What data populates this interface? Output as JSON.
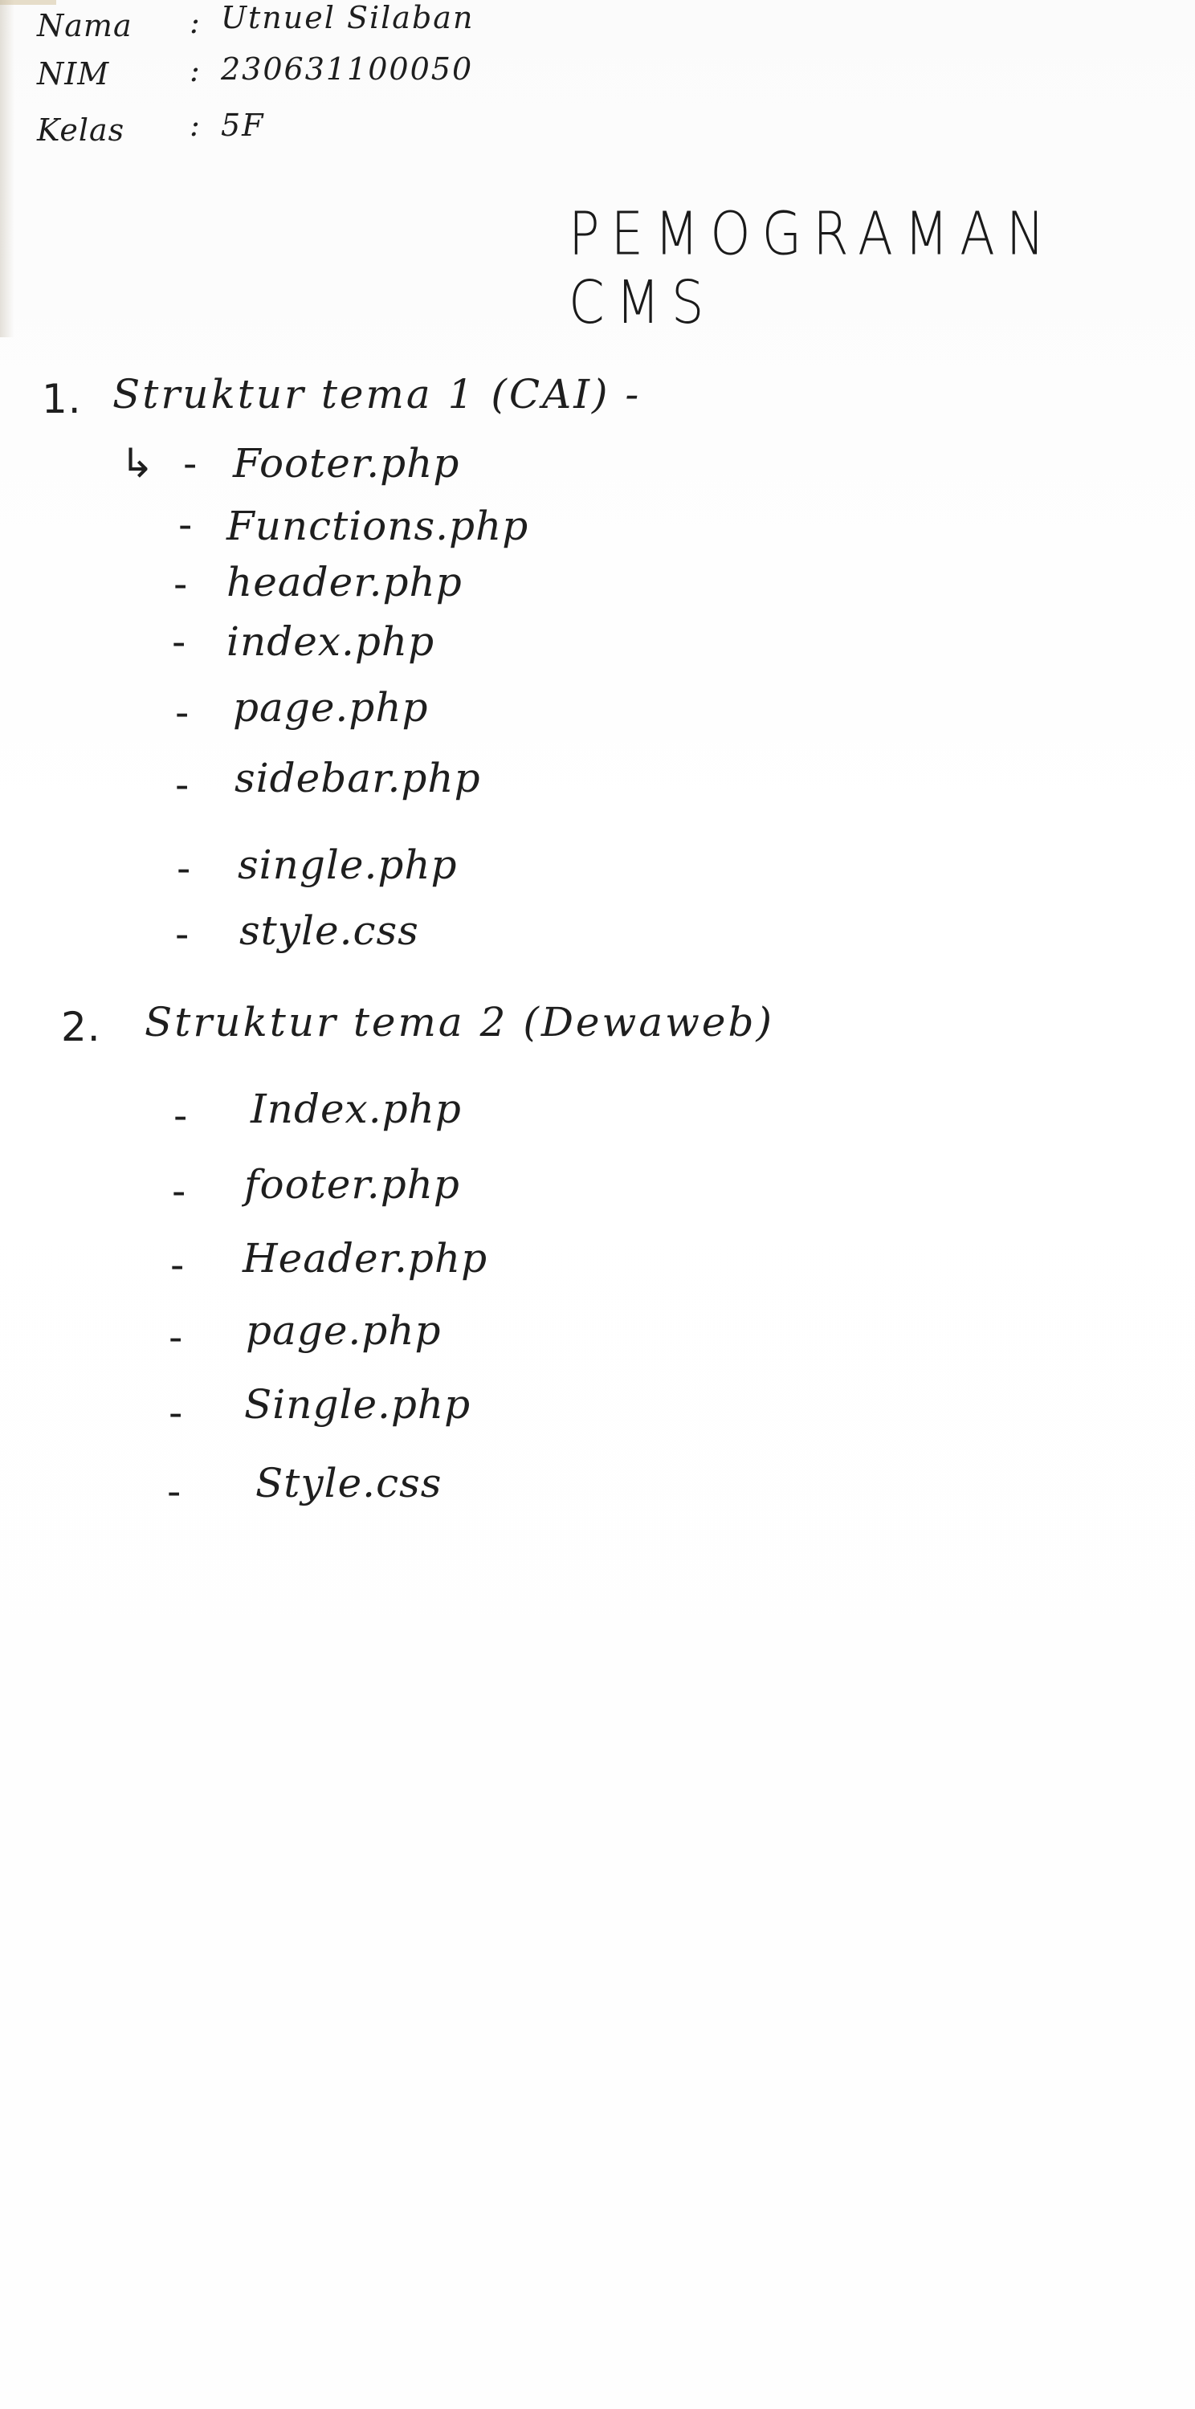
{
  "header": {
    "nama_label": "Nama",
    "nama_value": "Utnuel Silaban",
    "nim_label": "NIM",
    "nim_value": "230631100050",
    "kelas_label": "Kelas",
    "kelas_value": "5F",
    "colon": ":"
  },
  "title": "PEMOGRAMAN CMS",
  "sections": [
    {
      "number": "1.",
      "heading": "Struktur tema 1 (CAI) -",
      "arrow": "↳",
      "dash": "-",
      "items": [
        "Footer.php",
        "Functions.php",
        "header.php",
        "index.php",
        "page.php",
        "sidebar.php",
        "single.php",
        "style.css"
      ]
    },
    {
      "number": "2.",
      "heading": "Struktur tema 2 (Dewaweb)",
      "dash": "-",
      "items": [
        "Index.php",
        "footer.php",
        "Header.php",
        "page.php",
        "Single.php",
        "Style.css"
      ]
    }
  ]
}
